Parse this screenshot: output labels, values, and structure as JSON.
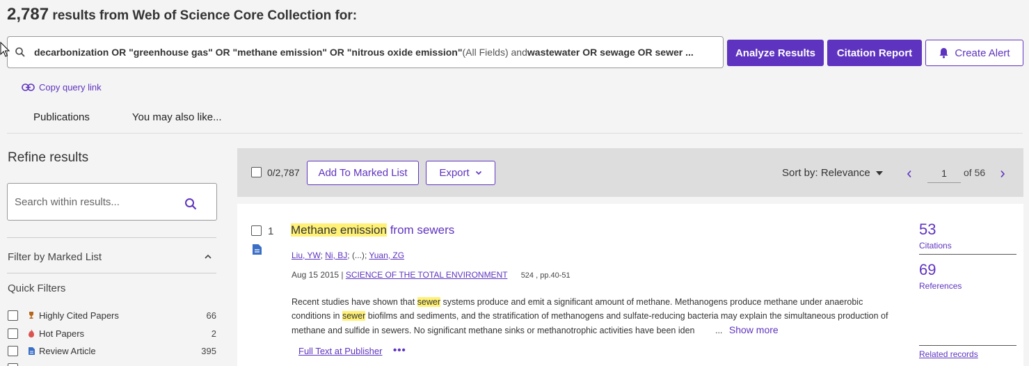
{
  "header": {
    "count": "2,787",
    "text": " results from Web of Science Core Collection for:"
  },
  "query": {
    "part1": "decarbonization OR \"greenhouse gas\" OR \"methane emission\" OR \"nitrous oxide emission\"",
    "field": " (All Fields) and ",
    "part2": "wastewater OR sewage OR sewer ..."
  },
  "actions": {
    "analyze": "Analyze Results",
    "citation_report": "Citation Report",
    "create_alert": "Create Alert"
  },
  "copy_query_link": "Copy query link",
  "tabs": [
    "Publications",
    "You may also like..."
  ],
  "sidebar": {
    "title": "Refine results",
    "search_placeholder": "Search within results...",
    "filter_marked": "Filter by Marked List",
    "quick_filters_title": "Quick Filters",
    "quick_filters": [
      {
        "label": "Highly Cited Papers",
        "count": "66",
        "icon": "trophy-icon"
      },
      {
        "label": "Hot Papers",
        "count": "2",
        "icon": "flame-icon"
      },
      {
        "label": "Review Article",
        "count": "395",
        "icon": "document-icon"
      }
    ]
  },
  "toolbar": {
    "marked": "0/2,787",
    "add_marked": "Add To Marked List",
    "export": "Export",
    "sort": "Sort by: Relevance",
    "page": "1",
    "of_pages": "of 56"
  },
  "record": {
    "number": "1",
    "title_hl": "Methane emission",
    "title_rest": " from sewers",
    "authors": [
      {
        "name": "Liu, YW",
        "link": true
      },
      {
        "name": "Ni, BJ",
        "link": true
      },
      {
        "name": "(...)",
        "link": false
      },
      {
        "name": "Yuan, ZG",
        "link": true
      }
    ],
    "date": "Aug 15 2015 | ",
    "journal": "SCIENCE OF THE TOTAL ENVIRONMENT",
    "pages": "524 , pp.40-51",
    "abstract_a": "Recent studies have shown that ",
    "abstract_hl1": "sewer",
    "abstract_b": " systems produce and emit a significant amount of methane. Methanogens produce methane under anaerobic conditions in ",
    "abstract_hl2": "sewer",
    "abstract_c": " biofilms and sediments, and the stratification of methanogens and sulfate-reducing bacteria may explain the simultaneous production of methane and sulfide in sewers. No significant methane sinks or methanotrophic activities have been iden",
    "ellipsis": "...",
    "show_more": "Show more",
    "full_text": "Full Text at Publisher",
    "more": "•••",
    "citations": "53",
    "citations_label": "Citations",
    "references": "69",
    "references_label": "References",
    "related": "Related records"
  },
  "colors": {
    "accent": "#5e33bf",
    "highlight": "#fff176"
  }
}
